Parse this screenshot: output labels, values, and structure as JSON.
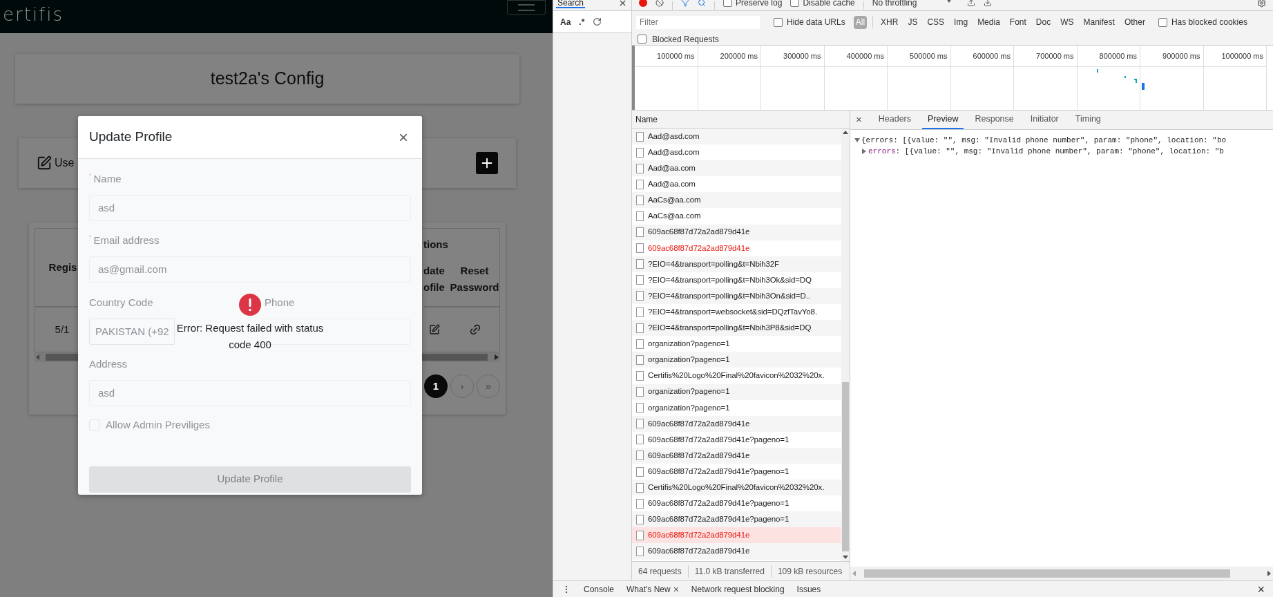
{
  "app": {
    "logo_text": "ertifis",
    "config_title": "test2a's Config",
    "users_bar": {
      "label": "Use"
    },
    "table": {
      "header_left": "Regis",
      "header_group": "tions",
      "columns": [
        {
          "lines": [
            "date",
            "ofile"
          ]
        },
        {
          "lines": [
            "Reset",
            "Password"
          ]
        }
      ],
      "rows": [
        {
          "date": "5/1"
        }
      ]
    },
    "pagination": [
      {
        "label": "1",
        "selected": true
      },
      {
        "label": "›",
        "selected": false
      },
      {
        "label": "»",
        "selected": false
      }
    ],
    "modal": {
      "title": "Update Profile",
      "close": "×",
      "fields": [
        {
          "label": "Name",
          "marker": "*",
          "value": "asd"
        },
        {
          "label": "Email address",
          "marker": "*",
          "value": "as@gmail.com"
        }
      ],
      "country": {
        "label": "Country Code",
        "value": "PAKISTAN (+92"
      },
      "phone": {
        "label": "Phone"
      },
      "address": {
        "label": "Address",
        "value": "asd"
      },
      "admin_checkbox": {
        "label": "Allow Admin Previliges",
        "checked": false
      },
      "submit": {
        "label": "Update Profile",
        "disabled": true
      },
      "error_toast": {
        "message": "Error: Request failed with status code 400"
      }
    }
  },
  "devtools": {
    "search_panel": {
      "tab": "Search",
      "options": [
        "Aa",
        ".*"
      ]
    },
    "toolbar": {
      "recording": true,
      "checkboxes": [
        {
          "label": "Preserve log",
          "checked": false
        },
        {
          "label": "Disable cache",
          "checked": false
        }
      ],
      "throttling": "No throttling"
    },
    "filter": {
      "placeholder": "Filter",
      "hide_data_urls": {
        "label": "Hide data URLs",
        "checked": false
      },
      "types": [
        {
          "label": "All",
          "selected": true
        },
        {
          "label": "XHR",
          "selected": false
        },
        {
          "label": "JS",
          "selected": false
        },
        {
          "label": "CSS",
          "selected": false
        },
        {
          "label": "Img",
          "selected": false
        },
        {
          "label": "Media",
          "selected": false
        },
        {
          "label": "Font",
          "selected": false
        },
        {
          "label": "Doc",
          "selected": false
        },
        {
          "label": "WS",
          "selected": false
        },
        {
          "label": "Manifest",
          "selected": false
        },
        {
          "label": "Other",
          "selected": false
        }
      ],
      "has_blocked_cookies": {
        "label": "Has blocked cookies",
        "checked": false
      },
      "blocked_requests": {
        "label": "Blocked Requests",
        "checked": false
      }
    },
    "overview": {
      "ticks": [
        "100000 ms",
        "200000 ms",
        "300000 ms",
        "400000 ms",
        "500000 ms",
        "600000 ms",
        "700000 ms",
        "800000 ms",
        "900000 ms",
        "1000000 ms"
      ]
    },
    "requests": {
      "column": "Name",
      "rows": [
        {
          "name": "Aad@asd.com",
          "error": false,
          "selected": false
        },
        {
          "name": "Aad@asd.com",
          "error": false,
          "selected": false
        },
        {
          "name": "Aad@aa.com",
          "error": false,
          "selected": false
        },
        {
          "name": "Aad@aa.com",
          "error": false,
          "selected": false
        },
        {
          "name": "AaCs@aa.com",
          "error": false,
          "selected": false
        },
        {
          "name": "AaCs@aa.com",
          "error": false,
          "selected": false
        },
        {
          "name": "609ac68f87d72a2ad879d41e",
          "error": false,
          "selected": false
        },
        {
          "name": "609ac68f87d72a2ad879d41e",
          "error": true,
          "selected": false
        },
        {
          "name": "?EIO=4&transport=polling&t=Nbih32F",
          "error": false,
          "selected": false
        },
        {
          "name": "?EIO=4&transport=polling&t=Nbih3Ok&sid=DQ",
          "error": false,
          "selected": false
        },
        {
          "name": "?EIO=4&transport=polling&t=Nbih3On&sid=D..",
          "error": false,
          "selected": false
        },
        {
          "name": "?EIO=4&transport=websocket&sid=DQzfTavYo8.",
          "error": false,
          "selected": false
        },
        {
          "name": "?EIO=4&transport=polling&t=Nbih3P8&sid=DQ",
          "error": false,
          "selected": false
        },
        {
          "name": "organization?pageno=1",
          "error": false,
          "selected": false
        },
        {
          "name": "organization?pageno=1",
          "error": false,
          "selected": false
        },
        {
          "name": "Certifis%20Logo%20Final%20favicon%2032%20x.",
          "error": false,
          "selected": false
        },
        {
          "name": "organization?pageno=1",
          "error": false,
          "selected": false
        },
        {
          "name": "organization?pageno=1",
          "error": false,
          "selected": false
        },
        {
          "name": "609ac68f87d72a2ad879d41e",
          "error": false,
          "selected": false
        },
        {
          "name": "609ac68f87d72a2ad879d41e?pageno=1",
          "error": false,
          "selected": false
        },
        {
          "name": "609ac68f87d72a2ad879d41e",
          "error": false,
          "selected": false
        },
        {
          "name": "609ac68f87d72a2ad879d41e?pageno=1",
          "error": false,
          "selected": false
        },
        {
          "name": "Certifis%20Logo%20Final%20favicon%2032%20x.",
          "error": false,
          "selected": false
        },
        {
          "name": "609ac68f87d72a2ad879d41e?pageno=1",
          "error": false,
          "selected": false
        },
        {
          "name": "609ac68f87d72a2ad879d41e?pageno=1",
          "error": false,
          "selected": false
        },
        {
          "name": "609ac68f87d72a2ad879d41e",
          "error": true,
          "selected": true
        },
        {
          "name": "609ac68f87d72a2ad879d41e",
          "error": false,
          "selected": false
        }
      ]
    },
    "status": [
      "64 requests",
      "11.0 kB transferred",
      "109 kB resources"
    ],
    "details": {
      "close": "×",
      "tabs": [
        {
          "label": "Headers",
          "selected": false
        },
        {
          "label": "Preview",
          "selected": true
        },
        {
          "label": "Response",
          "selected": false
        },
        {
          "label": "Initiator",
          "selected": false
        },
        {
          "label": "Timing",
          "selected": false
        }
      ],
      "preview_lines": [
        {
          "expanded": true,
          "text": "{errors: [{value: \"\", msg: \"Invalid phone number\", param: \"phone\", location: \"bo"
        },
        {
          "expanded": false,
          "key": "errors",
          "text": ": [{value: \"\", msg: \"Invalid phone number\", param: \"phone\", location: \"b"
        }
      ]
    },
    "drawer": {
      "tabs": [
        {
          "label": "Console",
          "closable": false
        },
        {
          "label": "What's New",
          "closable": true
        },
        {
          "label": "Network request blocking",
          "closable": false
        },
        {
          "label": "Issues",
          "closable": false
        }
      ],
      "tab_close": "×",
      "close": "×"
    }
  }
}
